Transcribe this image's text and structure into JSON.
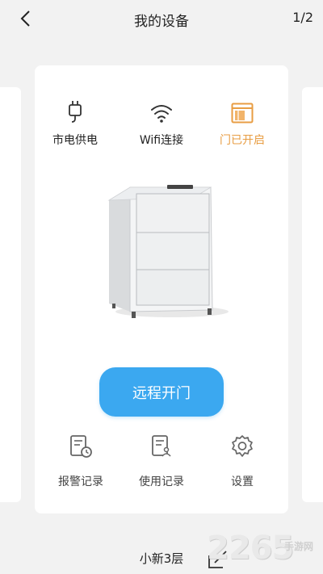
{
  "header": {
    "title": "我的设备",
    "pager": "1/2"
  },
  "status": {
    "power": "市电供电",
    "wifi": "Wifi连接",
    "door": "门已开启",
    "door_color": "#e89d43"
  },
  "remote_open_label": "远程开门",
  "actions": {
    "alarm": "报警记录",
    "usage": "使用记录",
    "settings": "设置"
  },
  "device_name": "小新3层",
  "watermark": {
    "brand": "2265",
    "sub": "手游网"
  },
  "colors": {
    "accent": "#3ba8f0",
    "background": "#f2f2f2"
  }
}
